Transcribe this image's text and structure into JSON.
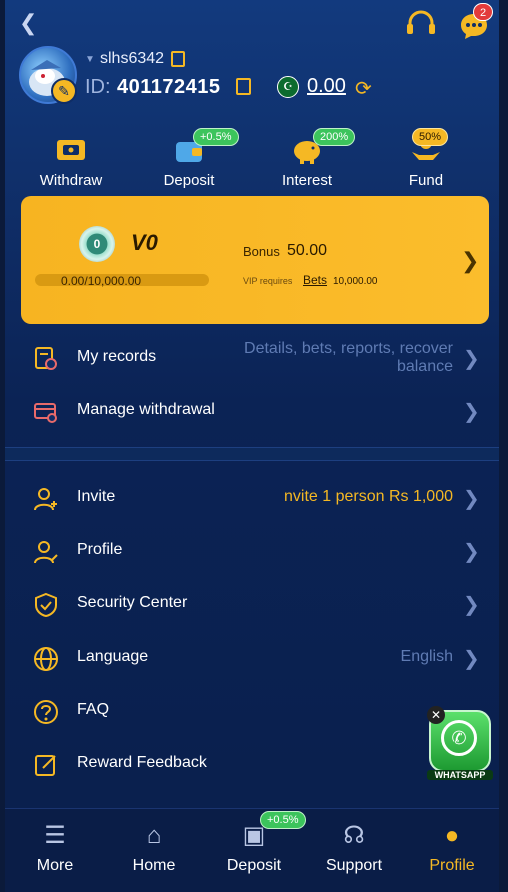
{
  "topbar": {
    "back_icon": "chevron-left-icon",
    "headset_icon": "headset-icon",
    "chat_icon": "chat-icon",
    "chat_badge": "2"
  },
  "profile": {
    "username": "slhs6342",
    "id_label": "ID:",
    "id_value": "401172415",
    "balance": "0.00",
    "flag": "pk-flag-icon"
  },
  "quick_actions": [
    {
      "label": "Withdraw",
      "icon": "ticket-icon",
      "badge": ""
    },
    {
      "label": "Deposit",
      "icon": "wallet-icon",
      "badge": "+0.5%"
    },
    {
      "label": "Interest",
      "icon": "piggy-bank-icon",
      "badge": "200%"
    },
    {
      "label": "Fund",
      "icon": "hand-coin-icon",
      "badge": "50%"
    }
  ],
  "vip": {
    "medal": "0",
    "level": "V0",
    "progress": "0.00/10,000.00",
    "bonus_label": "Bonus",
    "bonus_value": "50.00",
    "requires_label": "VIP requires",
    "bets_label": "Bets",
    "bets_amount": "10,000.00"
  },
  "rows_top": [
    {
      "label": "My records",
      "value": "Details, bets, reports, recover balance",
      "icon": "records-icon"
    },
    {
      "label": "Manage withdrawal",
      "value": "",
      "icon": "card-settings-icon"
    }
  ],
  "rows_bottom": [
    {
      "label": "Invite",
      "value": "nvite 1 person Rs 1,000",
      "icon": "invite-user-icon"
    },
    {
      "label": "Profile",
      "value": "",
      "icon": "user-edit-icon"
    },
    {
      "label": "Security Center",
      "value": "",
      "icon": "shield-check-icon"
    },
    {
      "label": "Language",
      "value": "English",
      "icon": "globe-icon"
    },
    {
      "label": "FAQ",
      "value": "",
      "icon": "question-icon"
    },
    {
      "label": "Reward Feedback",
      "value": "",
      "icon": "feedback-edit-icon"
    }
  ],
  "whatsapp": {
    "label": "WHATSAPP"
  },
  "nav": [
    {
      "label": "More",
      "icon": "menu-icon"
    },
    {
      "label": "Home",
      "icon": "home-icon"
    },
    {
      "label": "Deposit",
      "icon": "wallet-icon",
      "badge": "+0.5%"
    },
    {
      "label": "Support",
      "icon": "headset-icon"
    },
    {
      "label": "Profile",
      "icon": "user-icon"
    }
  ],
  "colors": {
    "accent": "#f5b824",
    "background": "#0f2d66",
    "vip_card": "#fbbd2c",
    "badge_green": "#3cc45c"
  }
}
